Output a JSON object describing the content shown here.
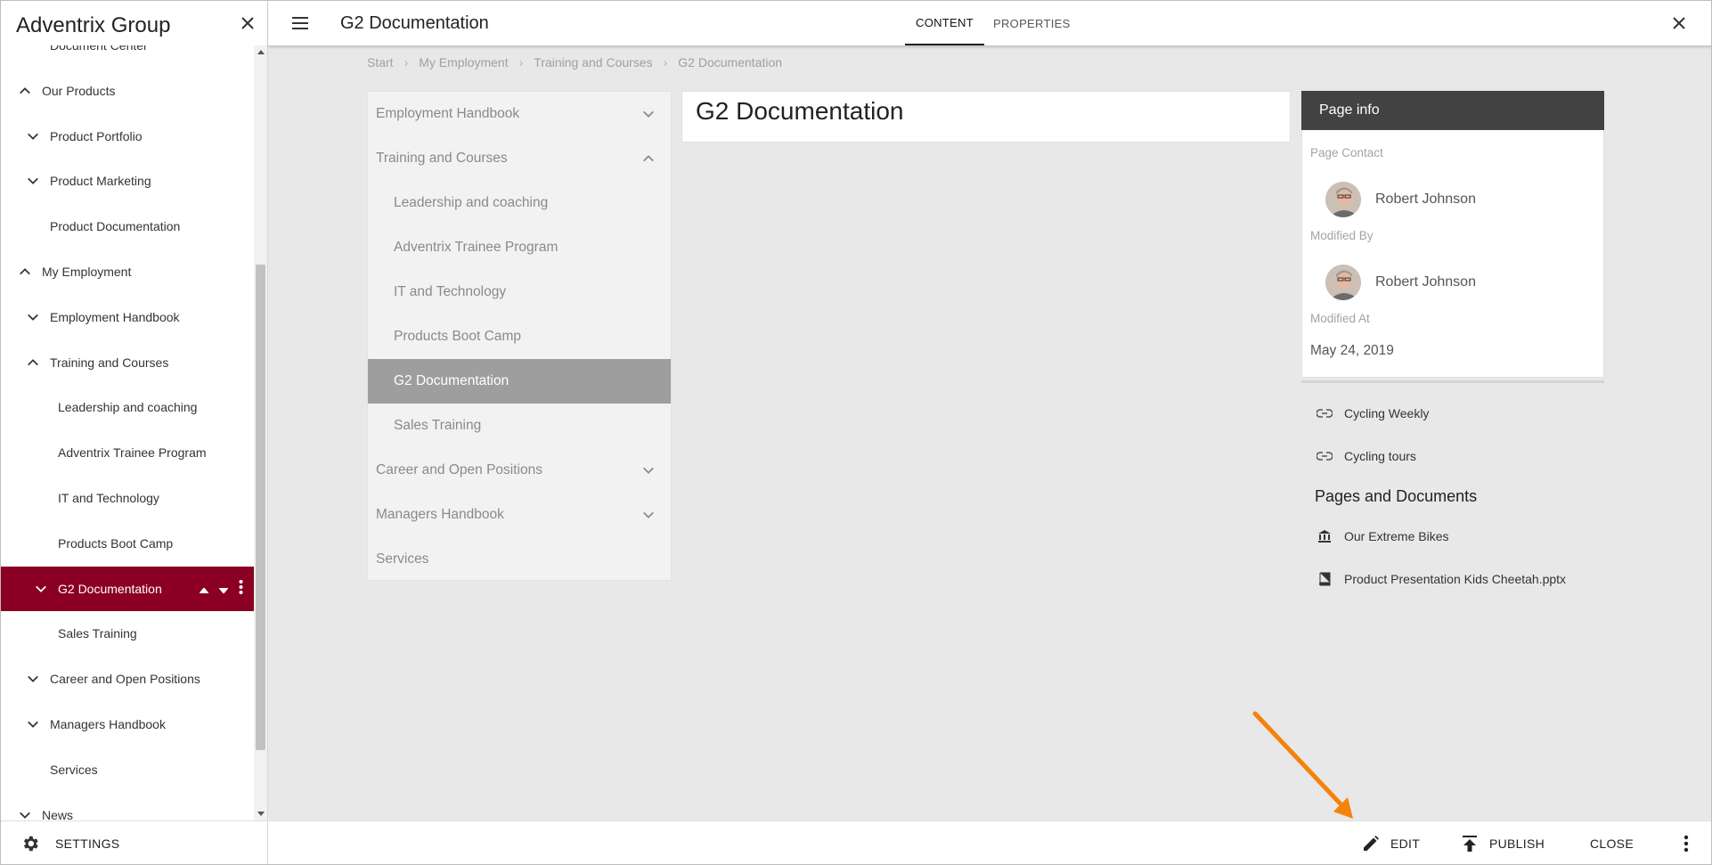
{
  "sidebar": {
    "title": "Adventrix Group",
    "items": [
      {
        "label": "Document Center",
        "indent": 1,
        "chevron": "none"
      },
      {
        "label": "Our Products",
        "indent": 0,
        "chevron": "up"
      },
      {
        "label": "Product Portfolio",
        "indent": 1,
        "chevron": "down"
      },
      {
        "label": "Product Marketing",
        "indent": 1,
        "chevron": "down"
      },
      {
        "label": "Product Documentation",
        "indent": 1,
        "chevron": "none"
      },
      {
        "label": "My Employment",
        "indent": 0,
        "chevron": "up"
      },
      {
        "label": "Employment Handbook",
        "indent": 1,
        "chevron": "down"
      },
      {
        "label": "Training and Courses",
        "indent": 1,
        "chevron": "up"
      },
      {
        "label": "Leadership and coaching",
        "indent": 2,
        "chevron": "none"
      },
      {
        "label": "Adventrix Trainee Program",
        "indent": 2,
        "chevron": "none"
      },
      {
        "label": "IT and Technology",
        "indent": 2,
        "chevron": "none"
      },
      {
        "label": "Products Boot Camp",
        "indent": 2,
        "chevron": "none"
      },
      {
        "label": "G2 Documentation",
        "indent": 2,
        "chevron": "down",
        "active": true
      },
      {
        "label": "Sales Training",
        "indent": 2,
        "chevron": "none"
      },
      {
        "label": "Career and Open Positions",
        "indent": 1,
        "chevron": "down"
      },
      {
        "label": "Managers Handbook",
        "indent": 1,
        "chevron": "down"
      },
      {
        "label": "Services",
        "indent": 1,
        "chevron": "none"
      },
      {
        "label": "News",
        "indent": 0,
        "chevron": "down"
      }
    ],
    "settings_label": "SETTINGS"
  },
  "header": {
    "title": "G2 Documentation",
    "tabs": [
      {
        "label": "CONTENT",
        "active": true
      },
      {
        "label": "PROPERTIES",
        "active": false
      }
    ]
  },
  "breadcrumb": [
    "Start",
    "My Employment",
    "Training and Courses",
    "G2 Documentation"
  ],
  "subnav": {
    "items": [
      {
        "label": "Employment Handbook",
        "chevron": "down",
        "indent": 0
      },
      {
        "label": "Training and Courses",
        "chevron": "up",
        "indent": 0
      },
      {
        "label": "Leadership and coaching",
        "chevron": "none",
        "indent": 1
      },
      {
        "label": "Adventrix Trainee Program",
        "chevron": "none",
        "indent": 1
      },
      {
        "label": "IT and Technology",
        "chevron": "none",
        "indent": 1
      },
      {
        "label": "Products Boot Camp",
        "chevron": "none",
        "indent": 1
      },
      {
        "label": "G2 Documentation",
        "chevron": "none",
        "indent": 1,
        "active": true
      },
      {
        "label": "Sales Training",
        "chevron": "none",
        "indent": 1
      },
      {
        "label": "Career and Open Positions",
        "chevron": "down",
        "indent": 0
      },
      {
        "label": "Managers Handbook",
        "chevron": "down",
        "indent": 0
      },
      {
        "label": "Services",
        "chevron": "none",
        "indent": 0
      }
    ]
  },
  "content": {
    "title": "G2 Documentation"
  },
  "page_info": {
    "heading": "Page info",
    "contact_label": "Page Contact",
    "contact_name": "Robert Johnson",
    "modified_by_label": "Modified By",
    "modified_by_name": "Robert Johnson",
    "modified_at_label": "Modified At",
    "modified_at": "May 24, 2019",
    "links": [
      {
        "label": "Cycling Weekly",
        "icon": "link-icon"
      },
      {
        "label": "Cycling tours",
        "icon": "link-icon"
      }
    ],
    "pages_title": "Pages and Documents",
    "pages": [
      {
        "label": "Our Extreme Bikes",
        "icon": "bank-icon"
      },
      {
        "label": "Product Presentation Kids Cheetah.pptx",
        "icon": "book-icon"
      }
    ]
  },
  "bottombar": {
    "edit_label": "EDIT",
    "publish_label": "PUBLISH",
    "close_label": "CLOSE"
  },
  "colors": {
    "active_nav": "#8b0022",
    "annotation_arrow": "#f5820a",
    "info_header": "#424242"
  }
}
